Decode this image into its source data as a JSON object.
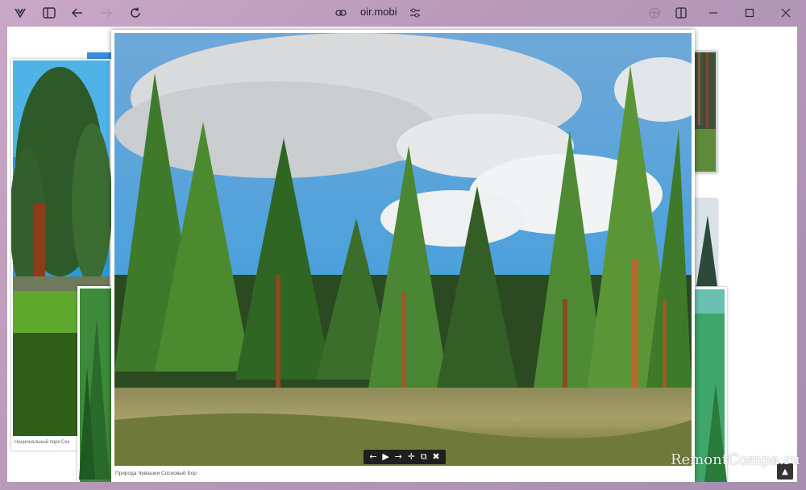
{
  "browser": {
    "url": "oir.mobi",
    "icons": {
      "app": "browser-logo-icon",
      "sidebar": "sidebar-toggle-icon",
      "back": "back-arrow-icon",
      "forward": "forward-arrow-icon",
      "reload": "reload-icon",
      "link": "link-icon",
      "site_settings": "tune-icon",
      "translate": "globe-icon",
      "split": "split-view-icon",
      "minimize": "minimize-icon",
      "maximize": "maximize-icon",
      "close": "close-icon"
    }
  },
  "background_gallery": {
    "left_caption": "Национальный парк Сек"
  },
  "lightbox": {
    "caption": "Природа Чувашии Сосновый Бор",
    "controls": {
      "prev": "←",
      "play": "▶",
      "next": "→",
      "move": "✛",
      "popout": "⧉",
      "close": "✖"
    }
  },
  "watermark": "RemontCompa.ru",
  "scroll_top": "▲"
}
